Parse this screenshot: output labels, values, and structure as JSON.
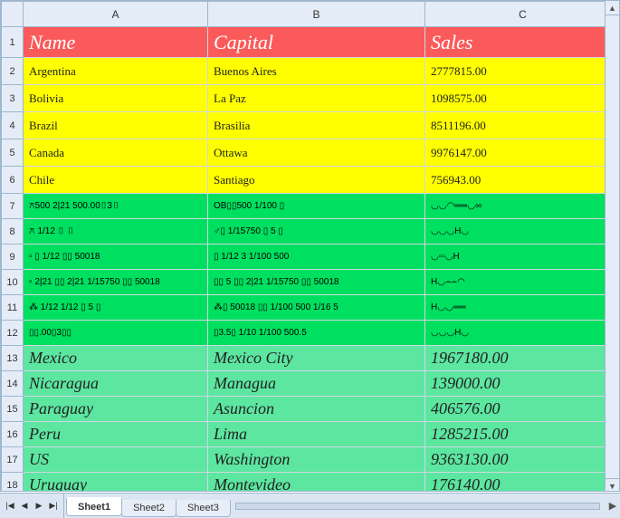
{
  "columns": [
    "A",
    "B",
    "C"
  ],
  "header_row": {
    "name": "Name",
    "capital": "Capital",
    "sales": "Sales"
  },
  "rows_yellow": [
    {
      "name": "Argentina",
      "capital": "Buenos Aires",
      "sales": "2777815.00"
    },
    {
      "name": "Bolivia",
      "capital": "La Paz",
      "sales": "1098575.00"
    },
    {
      "name": "Brazil",
      "capital": "Brasilia",
      "sales": "8511196.00"
    },
    {
      "name": "Canada",
      "capital": "Ottawa",
      "sales": "9976147.00"
    },
    {
      "name": "Chile",
      "capital": "Santiago",
      "sales": "756943.00"
    }
  ],
  "rows_green1": [
    {
      "a": "⚻500 2|21 500.00▯3▯",
      "b": "OB▯▯500 1/100 ▯",
      "c": "◡◡◠══◡∞"
    },
    {
      "a": "⚻ 1/12 ▯ ▯",
      "b": "♂▯ 1/15750 ▯ 5 ▯",
      "c": "◡◡◡H◡"
    },
    {
      "a": "▫ ▯ 1/12 ▯▯ 50018",
      "b": "▯ 1/12 3 1/100 500",
      "c": "◡▫▫◡H"
    },
    {
      "a": "▫ 2|21 ▯▯ 2|21 1/15750 ▯▯ 50018",
      "b": "▯▯ 5 ▯▯ 2|21 1/15750 ▯▯ 50018",
      "c": "H◡⌢⌢◠"
    },
    {
      "a": "⁂ 1/12 1/12 ▯ 5 ▯",
      "b": "⁂▯ 50018 ▯▯ 1/100 500 1/16 5",
      "c": "H◡◡══"
    },
    {
      "a": "▯▯.00▯3▯▯",
      "b": "▯3.5▯ 1/10 1/100 500.5",
      "c": "◡◡◡H◡"
    }
  ],
  "rows_green2": [
    {
      "name": "Mexico",
      "capital": "Mexico City",
      "sales": "1967180.00"
    },
    {
      "name": "Nicaragua",
      "capital": "Managua",
      "sales": "139000.00"
    },
    {
      "name": "Paraguay",
      "capital": "Asuncion",
      "sales": "406576.00"
    },
    {
      "name": "Peru",
      "capital": "Lima",
      "sales": "1285215.00"
    },
    {
      "name": "US",
      "capital": "Washington",
      "sales": "9363130.00"
    },
    {
      "name": "Uruguay",
      "capital": "Montevideo",
      "sales": "176140.00"
    }
  ],
  "tabs": [
    "Sheet1",
    "Sheet2",
    "Sheet3"
  ],
  "active_tab": "Sheet1",
  "nav": {
    "first": "|◀",
    "prev": "◀",
    "next": "▶",
    "last": "▶|"
  }
}
